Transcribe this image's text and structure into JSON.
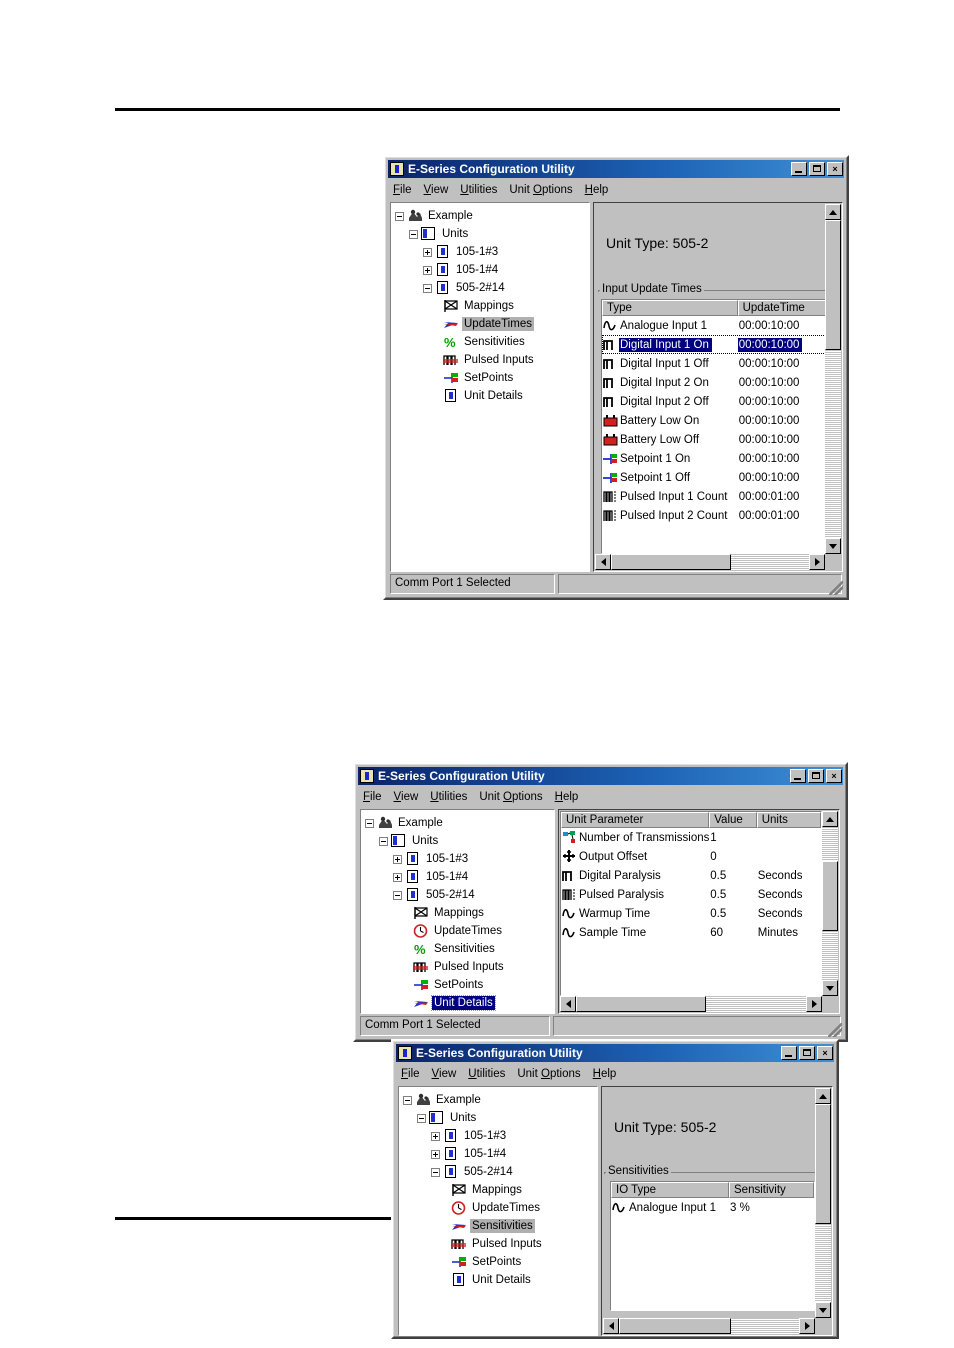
{
  "app": {
    "title": "E-Series Configuration Utility",
    "menus": [
      {
        "label": "File",
        "accel": "F"
      },
      {
        "label": "View",
        "accel": "V"
      },
      {
        "label": "Utilities",
        "accel": "U"
      },
      {
        "label": "Unit Options",
        "accel": "O"
      },
      {
        "label": "Help",
        "accel": "H"
      }
    ],
    "window_buttons": {
      "minimize": "minimize-button",
      "maximize": "maximize-button",
      "close": "×"
    },
    "status_text": "Comm Port 1 Selected"
  },
  "tree": {
    "root": "Example",
    "units_node": "Units",
    "units": [
      "105-1#3",
      "105-1#4",
      "505-2#14"
    ],
    "children": [
      {
        "label": "Mappings",
        "icon": "mappings-icon"
      },
      {
        "label": "UpdateTimes",
        "icon": "clock-icon"
      },
      {
        "label": "Sensitivities",
        "icon": "percent-icon"
      },
      {
        "label": "Pulsed Inputs",
        "icon": "pulse-icon"
      },
      {
        "label": "SetPoints",
        "icon": "setpoint-icon"
      },
      {
        "label": "Unit Details",
        "icon": "unit-icon"
      }
    ]
  },
  "window1": {
    "title": "E-Series Configuration Utility",
    "selected_tree_item": "UpdateTimes",
    "unit_type": "Unit Type: 505-2",
    "group_label": "Input Update Times",
    "columns": [
      "Type",
      "UpdateTime"
    ],
    "rows": [
      {
        "icon": "analogue-icon",
        "type": "Analogue Input 1",
        "time": "00:00:10:00",
        "selected": false
      },
      {
        "icon": "digital-icon",
        "type": "Digital Input 1 On",
        "time": "00:00:10:00",
        "selected": true
      },
      {
        "icon": "digital-icon",
        "type": "Digital Input 1 Off",
        "time": "00:00:10:00",
        "selected": false
      },
      {
        "icon": "digital-icon",
        "type": "Digital Input 2 On",
        "time": "00:00:10:00",
        "selected": false
      },
      {
        "icon": "digital-icon",
        "type": "Digital Input 2 Off",
        "time": "00:00:10:00",
        "selected": false
      },
      {
        "icon": "battery-icon",
        "type": "Battery Low On",
        "time": "00:00:10:00",
        "selected": false
      },
      {
        "icon": "battery-icon",
        "type": "Battery Low Off",
        "time": "00:00:10:00",
        "selected": false
      },
      {
        "icon": "setpoint-icon",
        "type": "Setpoint 1 On",
        "time": "00:00:10:00",
        "selected": false
      },
      {
        "icon": "setpoint-icon",
        "type": "Setpoint 1 Off",
        "time": "00:00:10:00",
        "selected": false
      },
      {
        "icon": "pulsed-icon",
        "type": "Pulsed Input 1 Count",
        "time": "00:00:01:00",
        "selected": false
      },
      {
        "icon": "pulsed-icon",
        "type": "Pulsed Input 2 Count",
        "time": "00:00:01:00",
        "selected": false
      }
    ],
    "status_text": "Comm Port 1 Selected"
  },
  "window2": {
    "title": "E-Series Configuration Utility",
    "selected_tree_item": "Unit Details",
    "columns": [
      "Unit Parameter",
      "Value",
      "Units"
    ],
    "rows": [
      {
        "icon": "transmissions-icon",
        "parameter": "Number of Transmissions",
        "value": "1",
        "units": ""
      },
      {
        "icon": "offset-icon",
        "parameter": "Output Offset",
        "value": "0",
        "units": ""
      },
      {
        "icon": "digital-icon",
        "parameter": "Digital Paralysis",
        "value": "0.5",
        "units": "Seconds"
      },
      {
        "icon": "pulsed-icon",
        "parameter": "Pulsed Paralysis",
        "value": "0.5",
        "units": "Seconds"
      },
      {
        "icon": "analogue-icon",
        "parameter": "Warmup Time",
        "value": "0.5",
        "units": "Seconds"
      },
      {
        "icon": "analogue-icon",
        "parameter": "Sample Time",
        "value": "60",
        "units": "Minutes"
      }
    ],
    "status_text": "Comm Port 1 Selected"
  },
  "window3": {
    "title": "E-Series Configuration Utility",
    "selected_tree_item": "Sensitivities",
    "unit_type": "Unit Type: 505-2",
    "group_label": "Sensitivities",
    "columns": [
      "IO Type",
      "Sensitivity"
    ],
    "rows": [
      {
        "icon": "analogue-icon",
        "io_type": "Analogue Input 1",
        "sensitivity": "3 %"
      }
    ]
  },
  "colors": {
    "title_active_left": "#0a246a",
    "title_active_right": "#3e8fd6",
    "face": "#c0c0c0",
    "selection": "#000080",
    "selection_grey": "#b0b0b0",
    "icon_red": "#d02020",
    "icon_blue": "#2030d0",
    "icon_green": "#00a000"
  }
}
